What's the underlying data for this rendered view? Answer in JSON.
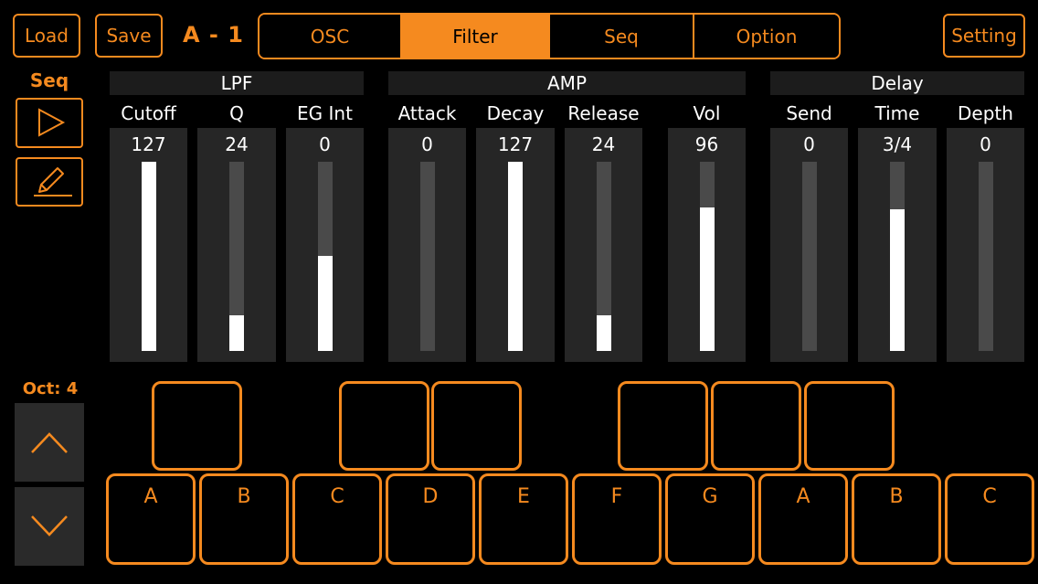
{
  "header": {
    "load_label": "Load",
    "save_label": "Save",
    "patch_name": "A - 1",
    "tabs": [
      {
        "label": "OSC",
        "active": false
      },
      {
        "label": "Filter",
        "active": true
      },
      {
        "label": "Seq",
        "active": false
      },
      {
        "label": "Option",
        "active": false
      }
    ],
    "setting_label": "Setting"
  },
  "seq_panel": {
    "title": "Seq",
    "play_icon": "play-icon",
    "edit_icon": "pencil-icon"
  },
  "groups": [
    {
      "name": "LPF",
      "params": [
        {
          "label": "Cutoff",
          "value": "127",
          "level": 1.0
        },
        {
          "label": "Q",
          "value": "24",
          "level": 0.19
        },
        {
          "label": "EG Int",
          "value": "0",
          "level": 0.5
        }
      ]
    },
    {
      "name": "AMP",
      "params": [
        {
          "label": "Attack",
          "value": "0",
          "level": 0.0
        },
        {
          "label": "Decay",
          "value": "127",
          "level": 1.0
        },
        {
          "label": "Release",
          "value": "24",
          "level": 0.19
        },
        {
          "label": "Vol",
          "value": "96",
          "level": 0.76
        }
      ]
    },
    {
      "name": "Delay",
      "params": [
        {
          "label": "Send",
          "value": "0",
          "level": 0.0
        },
        {
          "label": "Time",
          "value": "3/4",
          "level": 0.75
        },
        {
          "label": "Depth",
          "value": "0",
          "level": 0.0
        }
      ]
    }
  ],
  "octave": {
    "label": "Oct: 4",
    "up_icon": "chevron-up-icon",
    "down_icon": "chevron-down-icon"
  },
  "keyboard": {
    "white_keys": [
      "A",
      "B",
      "C",
      "D",
      "E",
      "F",
      "G",
      "A",
      "B",
      "C"
    ],
    "black_key_count": 6
  },
  "colors": {
    "accent": "#f58a1f",
    "background": "#000000",
    "panel": "#262626",
    "track": "#4a4a4a",
    "fill": "#ffffff"
  }
}
